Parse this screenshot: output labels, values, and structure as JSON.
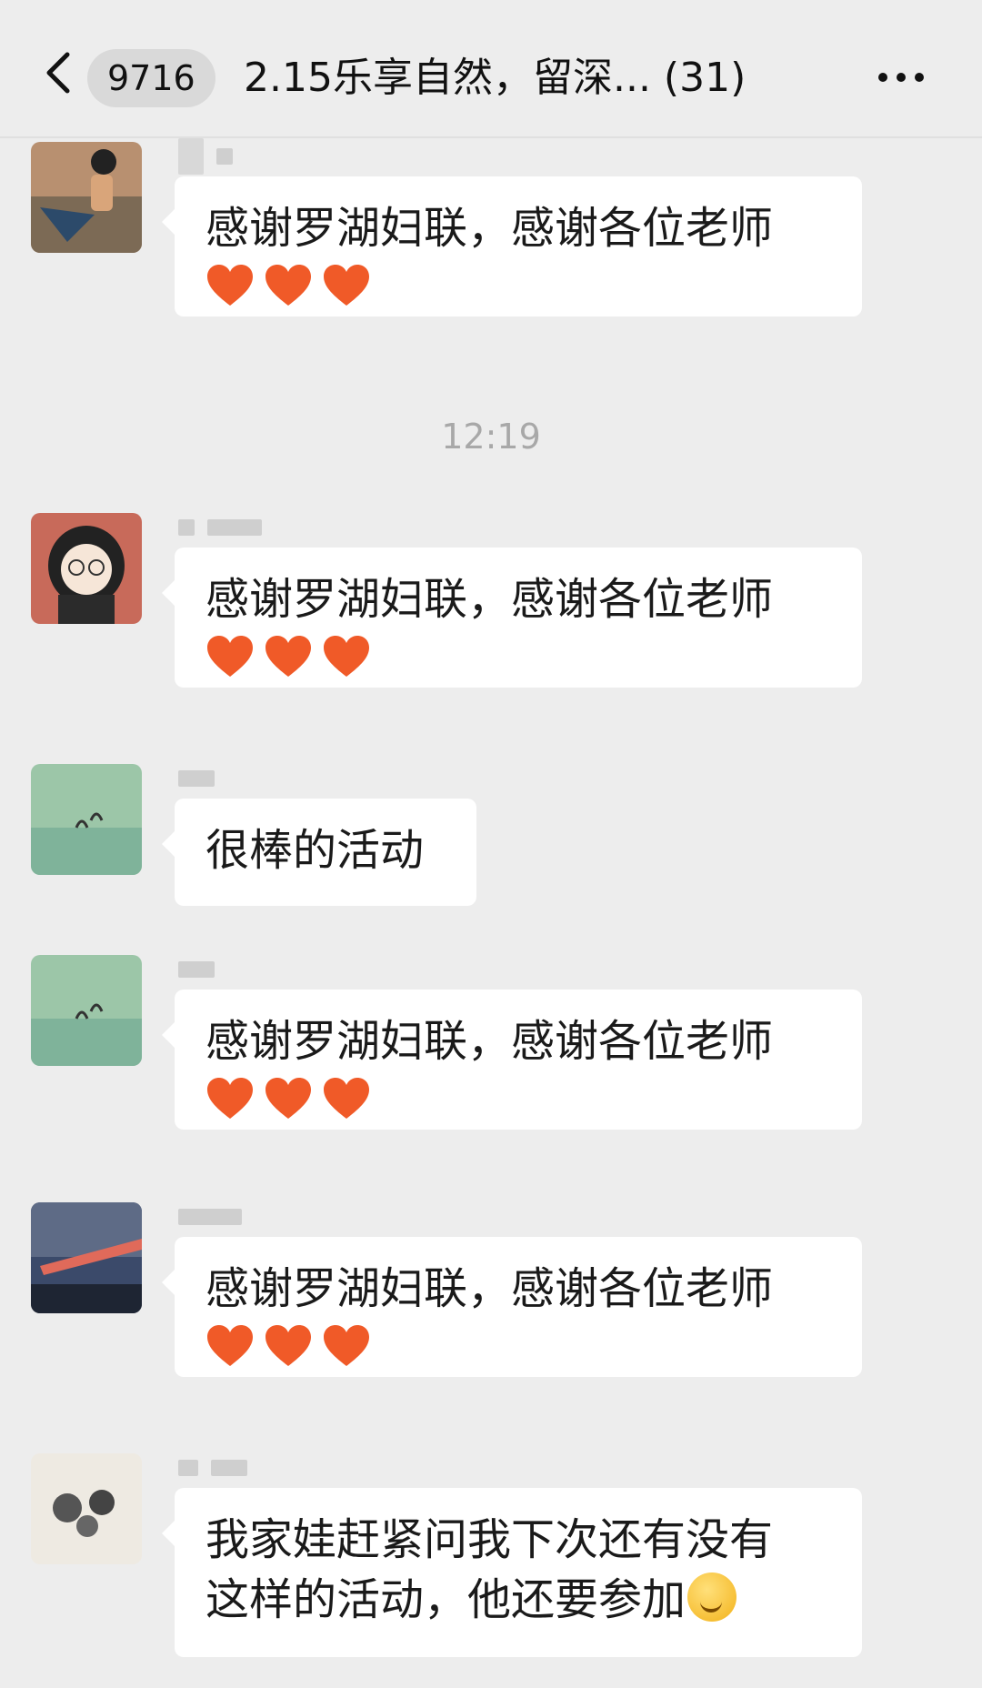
{
  "header": {
    "unread_count": "9716",
    "title": "2.15乐享自然，留深... (31)"
  },
  "timestamp": "12:19",
  "messages": [
    {
      "text": "感谢罗湖妇联，感谢各位老师",
      "hearts": 3
    },
    {
      "text": "感谢罗湖妇联，感谢各位老师",
      "hearts": 3
    },
    {
      "text": "很棒的活动",
      "hearts": 0
    },
    {
      "text": "感谢罗湖妇联，感谢各位老师",
      "hearts": 3
    },
    {
      "text": "感谢罗湖妇联，感谢各位老师",
      "hearts": 3
    },
    {
      "text_line1": "我家娃赶紧问我下次还有没有",
      "text_line2": "这样的活动，他还要参加",
      "emoji": "thinking-face-emoji"
    }
  ],
  "colors": {
    "background": "#ededed",
    "bubble": "#ffffff",
    "heart": "#f05a28"
  }
}
